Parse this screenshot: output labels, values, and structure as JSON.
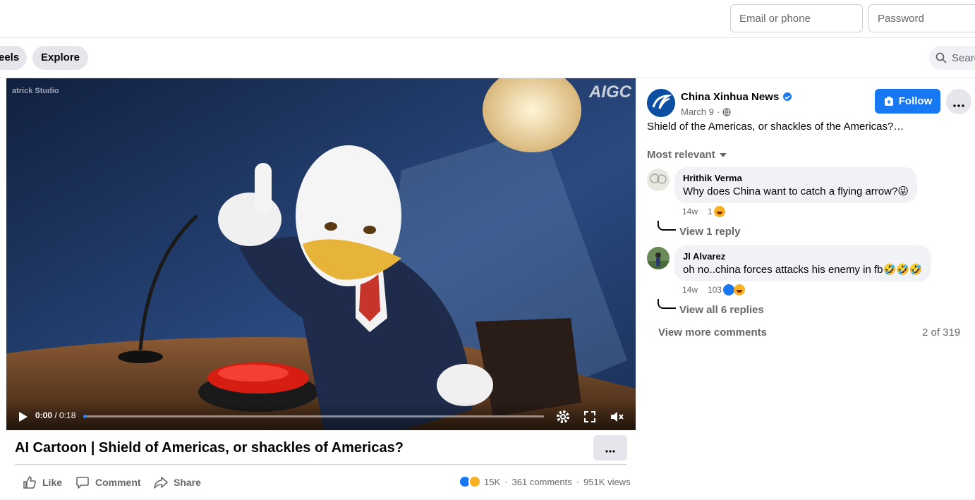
{
  "header": {
    "email_placeholder": "Email or phone",
    "password_placeholder": "Password"
  },
  "nav": {
    "reels_label": "eels",
    "explore_label": "Explore",
    "search_placeholder": "Searc"
  },
  "video": {
    "current_time": "0:00",
    "duration": "/ 0:18",
    "progress": 0,
    "watermark_left": "atrick Studio",
    "watermark_right": "AIGC"
  },
  "post": {
    "title": "AI Cartoon | Shield of Americas, or shackles of Americas?",
    "actions": {
      "like": "Like",
      "comment": "Comment",
      "share": "Share"
    },
    "reactions_count": "15K",
    "comments_count": "361 comments",
    "views_count": "951K views",
    "separator": "·"
  },
  "page": {
    "name": "China Xinhua News",
    "date": "March 9",
    "date_sep": "·",
    "follow_label": "Follow",
    "caption": "Shield of the Americas, or shackles of the Americas?…",
    "sort_label": "Most relevant"
  },
  "comments": [
    {
      "author": "Hrithik Verma",
      "text": "Why does China want to catch a flying arrow?😜",
      "age": "14w",
      "reaction_count": "1",
      "reply_link": "View 1 reply"
    },
    {
      "author": "Jl Alvarez",
      "text": "oh no..china forces attacks his enemy in fb🤣🤣🤣",
      "age": "14w",
      "reaction_count": "103",
      "reply_link": "View all 6 replies"
    }
  ],
  "footer": {
    "more_comments": "View more comments",
    "count": "2 of 319"
  },
  "colors": {
    "accent": "#1877f2",
    "secondary_text": "#65676b"
  }
}
